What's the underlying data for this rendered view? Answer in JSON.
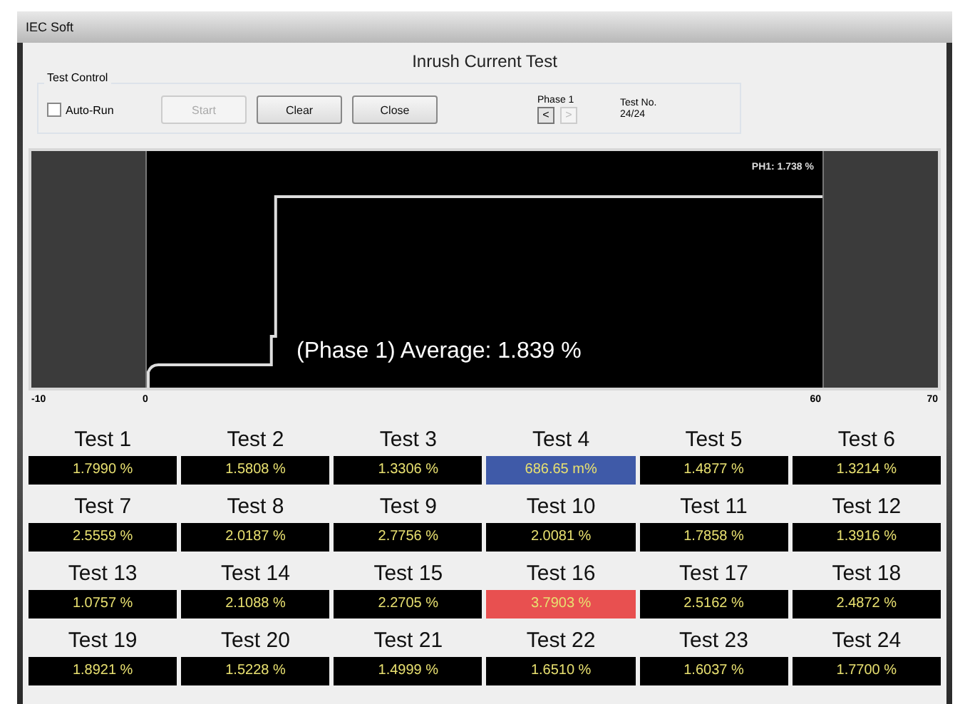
{
  "window": {
    "title": "IEC Soft"
  },
  "dialog": {
    "title": "Inrush Current Test"
  },
  "test_control": {
    "label": "Test Control",
    "auto_run": {
      "label": "Auto-Run",
      "checked": false
    },
    "buttons": [
      {
        "label": "Start",
        "disabled": true
      },
      {
        "label": "Clear",
        "disabled": false
      },
      {
        "label": "Close",
        "disabled": false
      }
    ],
    "phase": {
      "label": "Phase 1",
      "prev": {
        "label": "<",
        "disabled": false
      },
      "next": {
        "label": ">",
        "disabled": true
      }
    },
    "test_no": {
      "label": "Test No.",
      "value": "24/24"
    }
  },
  "chart": {
    "readout": "PH1: 1.738 %",
    "average": "(Phase 1) Average: 1.839 %",
    "x_labels": [
      "-10",
      "0",
      "60",
      "70"
    ]
  },
  "tests": [
    {
      "label": "Test 1",
      "value": "1.7990 %",
      "color": "#000000"
    },
    {
      "label": "Test 2",
      "value": "1.5808 %",
      "color": "#000000"
    },
    {
      "label": "Test 3",
      "value": "1.3306 %",
      "color": "#000000"
    },
    {
      "label": "Test 4",
      "value": "686.65 m%",
      "color": "#3f5aa8"
    },
    {
      "label": "Test 5",
      "value": "1.4877 %",
      "color": "#000000"
    },
    {
      "label": "Test 6",
      "value": "1.3214 %",
      "color": "#000000"
    },
    {
      "label": "Test 7",
      "value": "2.5559 %",
      "color": "#000000"
    },
    {
      "label": "Test 8",
      "value": "2.0187 %",
      "color": "#000000"
    },
    {
      "label": "Test 9",
      "value": "2.7756 %",
      "color": "#000000"
    },
    {
      "label": "Test 10",
      "value": "2.0081 %",
      "color": "#000000"
    },
    {
      "label": "Test 11",
      "value": "1.7858 %",
      "color": "#000000"
    },
    {
      "label": "Test 12",
      "value": "1.3916 %",
      "color": "#000000"
    },
    {
      "label": "Test 13",
      "value": "1.0757 %",
      "color": "#000000"
    },
    {
      "label": "Test 14",
      "value": "2.1088 %",
      "color": "#000000"
    },
    {
      "label": "Test 15",
      "value": "2.2705 %",
      "color": "#000000"
    },
    {
      "label": "Test 16",
      "value": "3.7903 %",
      "color": "#e85050"
    },
    {
      "label": "Test 17",
      "value": "2.5162 %",
      "color": "#000000"
    },
    {
      "label": "Test 18",
      "value": "2.4872 %",
      "color": "#000000"
    },
    {
      "label": "Test 19",
      "value": "1.8921 %",
      "color": "#000000"
    },
    {
      "label": "Test 20",
      "value": "1.5228 %",
      "color": "#000000"
    },
    {
      "label": "Test 21",
      "value": "1.4999 %",
      "color": "#000000"
    },
    {
      "label": "Test 22",
      "value": "1.6510 %",
      "color": "#000000"
    },
    {
      "label": "Test 23",
      "value": "1.6037 %",
      "color": "#000000"
    },
    {
      "label": "Test 24",
      "value": "1.7700 %",
      "color": "#000000"
    }
  ]
}
